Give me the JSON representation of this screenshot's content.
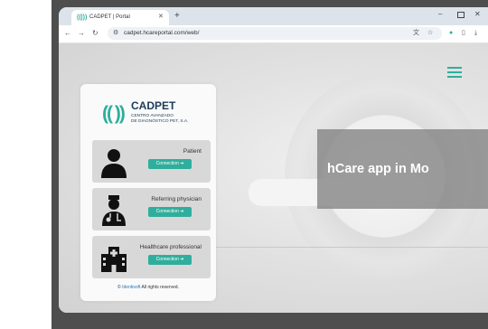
{
  "browser": {
    "tab_title": "CADPET | Portal",
    "tab_favicon": "((|))",
    "url": "cadpet.hcareportal.com/web/"
  },
  "login_card": {
    "logo_mark": "(( ))",
    "logo_name": "CADPET",
    "logo_subtitle_line1": "CENTRO AVANZADO",
    "logo_subtitle_line2": "DE DIAGNÓSTICO PET, S.A.",
    "options": [
      {
        "label": "Patient",
        "button": "Connection ➜",
        "icon": "person-icon"
      },
      {
        "label": "Referring physician",
        "button": "Connection ➜",
        "icon": "doctor-icon"
      },
      {
        "label": "Healthcare professional",
        "button": "Connection ➜",
        "icon": "hospital-icon"
      }
    ],
    "footer_prefix": "©",
    "footer_brand": "Identisoft",
    "footer_suffix": "All rights reserved."
  },
  "banner": {
    "text": "hCare app in Mo"
  },
  "colors": {
    "accent": "#2fae9d",
    "logo_text": "#1d3a5a",
    "banner_bg": "#828282"
  }
}
